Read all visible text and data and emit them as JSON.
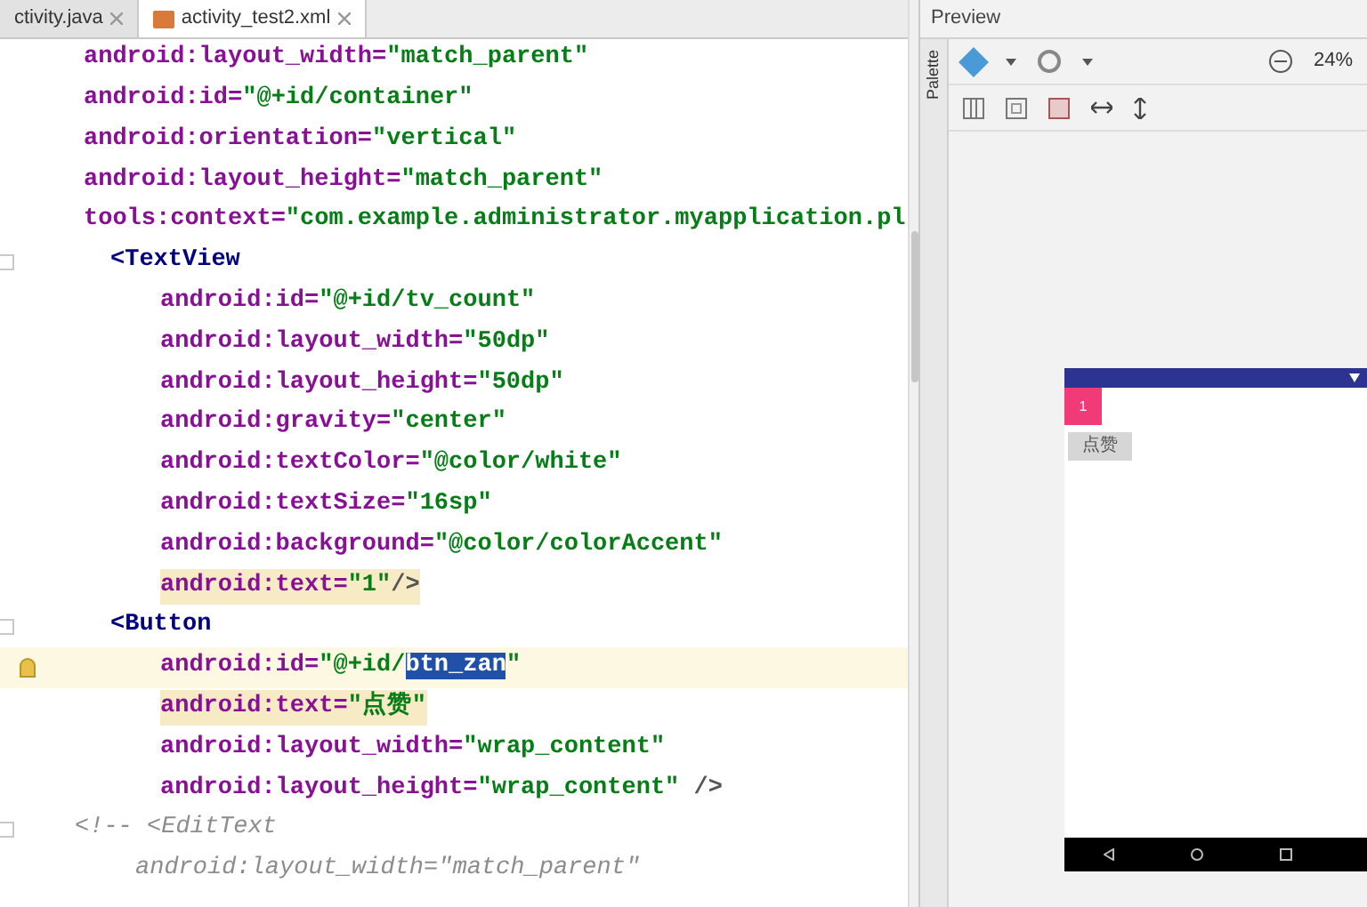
{
  "tabs": [
    {
      "label": "ctivity.java",
      "selected": false
    },
    {
      "label": "activity_test2.xml",
      "selected": true
    }
  ],
  "code": {
    "root_attrs": [
      {
        "name": "android:layout_width=",
        "value": "\"match_parent\"",
        "current_line": false,
        "warning": false
      },
      {
        "name": "android:id=",
        "value": "\"@+id/container\"",
        "current_line": false,
        "warning": false
      },
      {
        "name": "android:orientation=",
        "value": "\"vertical\"",
        "current_line": false,
        "warning": false
      },
      {
        "name": "android:layout_height=",
        "value": "\"match_parent\"",
        "current_line": false,
        "warning": false
      },
      {
        "name": "tools:context=",
        "value": "\"com.example.administrator.myapplication.pl",
        "current_line": false,
        "warning": false
      }
    ],
    "elements": [
      {
        "tag": "<TextView",
        "attrs": [
          {
            "name": "android:id=",
            "value": "\"@+id/tv_count\"",
            "current_line": false,
            "warning": false
          },
          {
            "name": "android:layout_width=",
            "value": "\"50dp\"",
            "current_line": false,
            "warning": false
          },
          {
            "name": "android:layout_height=",
            "value": "\"50dp\"",
            "current_line": false,
            "warning": false
          },
          {
            "name": "android:gravity=",
            "value": "\"center\"",
            "current_line": false,
            "warning": false
          },
          {
            "name": "android:textColor=",
            "value": "\"@color/white\"",
            "current_line": false,
            "warning": false
          },
          {
            "name": "android:textSize=",
            "value": "\"16sp\"",
            "current_line": false,
            "warning": false
          },
          {
            "name": "android:background=",
            "value": "\"@color/colorAccent\"",
            "current_line": false,
            "warning": false
          },
          {
            "name": "android:text=",
            "value": "\"1\"",
            "tail": "/>",
            "current_line": false,
            "warning": true
          }
        ]
      },
      {
        "tag": "<Button",
        "attrs": [
          {
            "name": "android:id=",
            "value": "\"@+id/",
            "selection": "btn_zan",
            "value_rest": "\"",
            "current_line": true,
            "warning": false
          },
          {
            "name": "android:text=",
            "value": "\"点赞\"",
            "current_line": false,
            "warning": true
          },
          {
            "name": "android:layout_width=",
            "value": "\"wrap_content\"",
            "current_line": false,
            "warning": false
          },
          {
            "name": "android:layout_height=",
            "value": "\"wrap_content\"",
            "tail": " />",
            "current_line": false,
            "warning": false
          }
        ]
      }
    ],
    "comment": {
      "open": "<!-- <EditText",
      "lines": [
        "android:layout_width=\"match_parent\""
      ]
    }
  },
  "preview": {
    "title": "Preview",
    "palette_label": "Palette",
    "zoom": "24%",
    "phone": {
      "counter_text": "1",
      "button_label": "点赞"
    }
  }
}
